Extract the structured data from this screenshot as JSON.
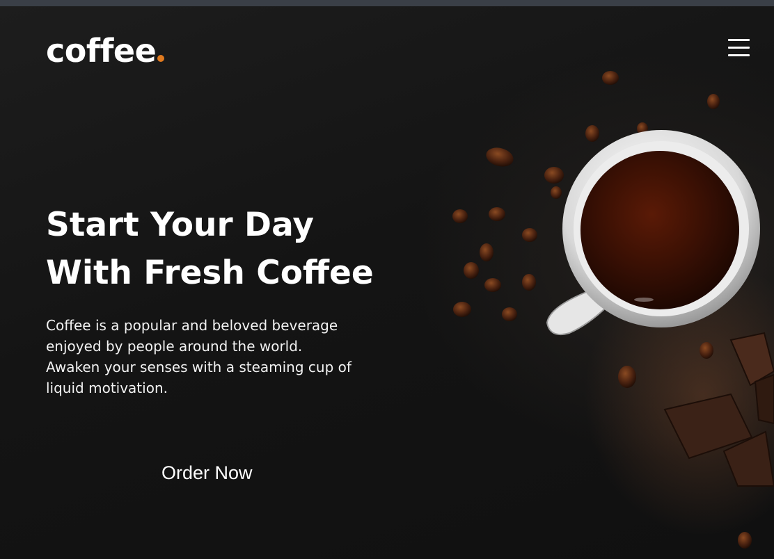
{
  "header": {
    "logo_text": "coffee",
    "logo_accent_color": "#e07a1f",
    "menu_icon": "hamburger-menu-icon"
  },
  "hero": {
    "headline_line1": "Start Your Day",
    "headline_line2": "With Fresh Coffee",
    "description_line1": "Coffee is a popular and beloved beverage",
    "description_line2": "enjoyed by people around the world.",
    "description_line3": "Awaken your senses with a steaming cup of",
    "description_line4": "liquid motivation.",
    "cta_label": "Order Now"
  },
  "image": {
    "subject": "coffee-cup-with-beans-and-chocolate"
  }
}
